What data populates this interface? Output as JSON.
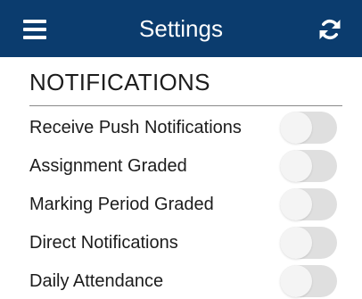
{
  "header": {
    "title": "Settings",
    "background": "#0b3c6e",
    "menu_icon": "hamburger-menu-icon",
    "refresh_icon": "refresh-icon"
  },
  "section": {
    "title": "NOTIFICATIONS"
  },
  "notifications": [
    {
      "label": "Receive Push Notifications",
      "enabled": false
    },
    {
      "label": "Assignment Graded",
      "enabled": false
    },
    {
      "label": "Marking Period Graded",
      "enabled": false
    },
    {
      "label": "Direct Notifications",
      "enabled": false
    },
    {
      "label": "Daily Attendance",
      "enabled": false
    }
  ],
  "toggle_colors": {
    "track_off": "#dfdfdf",
    "knob": "#f4f4f4"
  }
}
